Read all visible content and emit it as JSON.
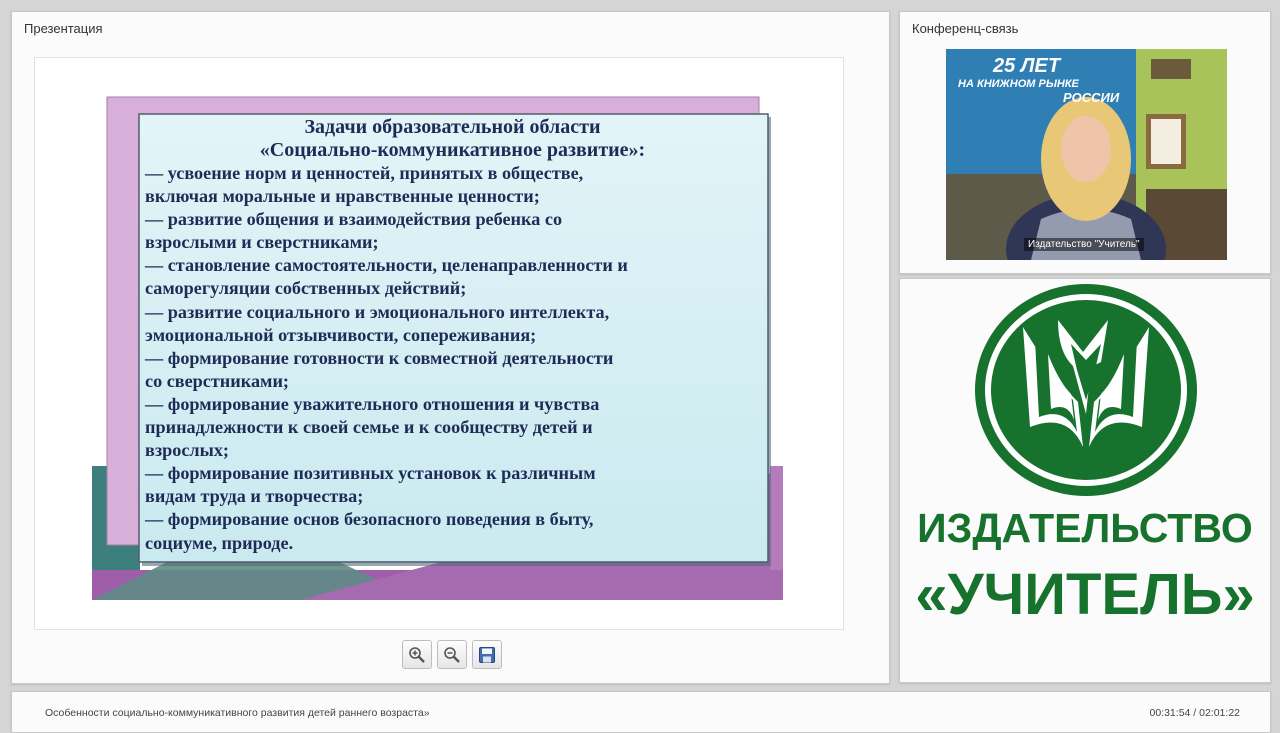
{
  "presentation": {
    "title": "Презентация",
    "slide": {
      "heading_line1": "Задачи образовательной области",
      "heading_line2": "«Социально-коммуникативное развитие»:",
      "lines": [
        "— усвоение норм и ценностей, принятых в обществе,",
        "включая моральные и нравственные ценности;",
        "— развитие общения и взаимодействия ребенка со",
        "взрослыми и сверстниками;",
        "— становление самостоятельности, целенаправленности и",
        "саморегуляции собственных действий;",
        "— развитие социального и эмоционального интеллекта,",
        "эмоциональной отзывчивости, сопереживания;",
        "— формирование готовности к совместной деятельности",
        "со сверстниками;",
        "— формирование уважительного отношения и чувства",
        "принадлежности к своей семье и к сообществу детей и",
        "взрослых;",
        "— формирование позитивных установок к различным",
        "видам труда и творчества;",
        "— формирование основ безопасного поведения в быту,",
        "социуме, природе."
      ]
    },
    "controls": {
      "zoom_in_icon": "zoom-in-icon",
      "zoom_out_icon": "zoom-out-icon",
      "save_icon": "save-icon"
    }
  },
  "conference": {
    "title": "Конференц-связь",
    "video_caption": "Издательство \"Учитель\"",
    "banner_text_1": "25 ЛЕТ",
    "banner_text_2": "НА КНИЖНОМ РЫНКЕ",
    "banner_text_3": "РОССИИ"
  },
  "logo": {
    "line1": "ИЗДАТЕЛЬСТВО",
    "line2": "«УЧИТЕЛЬ»",
    "brand_color": "#17722e"
  },
  "status_bar": {
    "webinar_title": "Особенности социально-коммуникативного развития детей раннего возраста»",
    "time": "00:31:54 / 02:01:22"
  }
}
